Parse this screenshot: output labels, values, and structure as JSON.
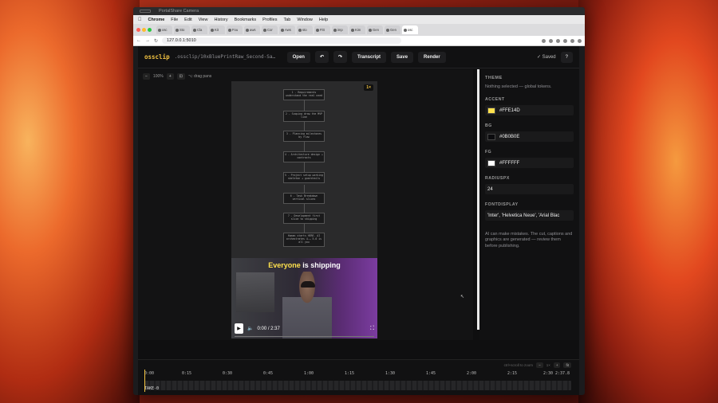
{
  "camera_title": "PortalShare Camera",
  "menubar": [
    "Chrome",
    "File",
    "Edit",
    "View",
    "History",
    "Bookmarks",
    "Profiles",
    "Tab",
    "Window",
    "Help"
  ],
  "tabs": [
    "osc",
    "Sto",
    "Cla",
    "Kit",
    "Fou",
    "aws",
    "Cor",
    "Aws",
    "sto",
    "Fitt",
    "imp",
    "Kim",
    "Gen",
    "Gen",
    "osc"
  ],
  "address": "127.0.0.1:5010",
  "app": {
    "brand": "ossclip",
    "file_path": ".ossclip/10xBluePrintRaw_Second-Sa…",
    "open": "Open",
    "undo": "↶",
    "redo": "↷",
    "transcript": "Transcript",
    "save": "Save",
    "render": "Render",
    "saved": "✓ Saved",
    "help": "?"
  },
  "zoom": {
    "minus": "−",
    "level": "100%",
    "plus": "+",
    "fit": "⊡",
    "hint": "⌥ drag pans"
  },
  "stage": {
    "badge": "1×",
    "flow": [
      "1 - Requirements understand the real need",
      "2 - Scoping draw the MVP line",
      "3 - Planning milestones by flow",
      "4 - Architecture design + contracts",
      "5 - Project setup working skeleton + guardrails",
      "6 - Task Breakdown vertical slices",
      "7 - Development first slice to shipping",
      "Human starts HERE. AI orchestrates 4-… 5-6 is all you"
    ],
    "caption_highlight": "Everyone",
    "caption_rest": " is shipping",
    "play": "▶",
    "volume": "🔈",
    "time": "0:00 / 2:37",
    "fullscreen": "⛶"
  },
  "panel": {
    "theme_title": "THEME",
    "theme_note": "Nothing selected — global tokens.",
    "accent_label": "ACCENT",
    "accent_value": "#FFE14D",
    "bg_label": "BG",
    "bg_value": "#0B0B0E",
    "fg_label": "FG",
    "fg_value": "#FFFFFF",
    "radius_label": "RADIUSPX",
    "radius_value": "24",
    "font_label": "FONTDISPLAY",
    "font_value": "'Inter', 'Helvetica Neue', 'Arial Blac",
    "disclaimer": "AI can make mistakes. The cut, captions and graphics are generated — review them before publishing."
  },
  "timeline": {
    "hint": "ctrl+scroll to zoom",
    "minus": "−",
    "level": "1×",
    "plus": "+",
    "fit": "fit",
    "ticks": [
      "0:00",
      "0:15",
      "0:30",
      "0:45",
      "1:00",
      "1:15",
      "1:30",
      "1:45",
      "2:00",
      "2:15",
      "2:30",
      "2:37.8"
    ],
    "track_label": "TAKE-0"
  },
  "colors": {
    "accent": "#FFE14D",
    "bg": "#0B0B0E",
    "fg": "#FFFFFF"
  }
}
